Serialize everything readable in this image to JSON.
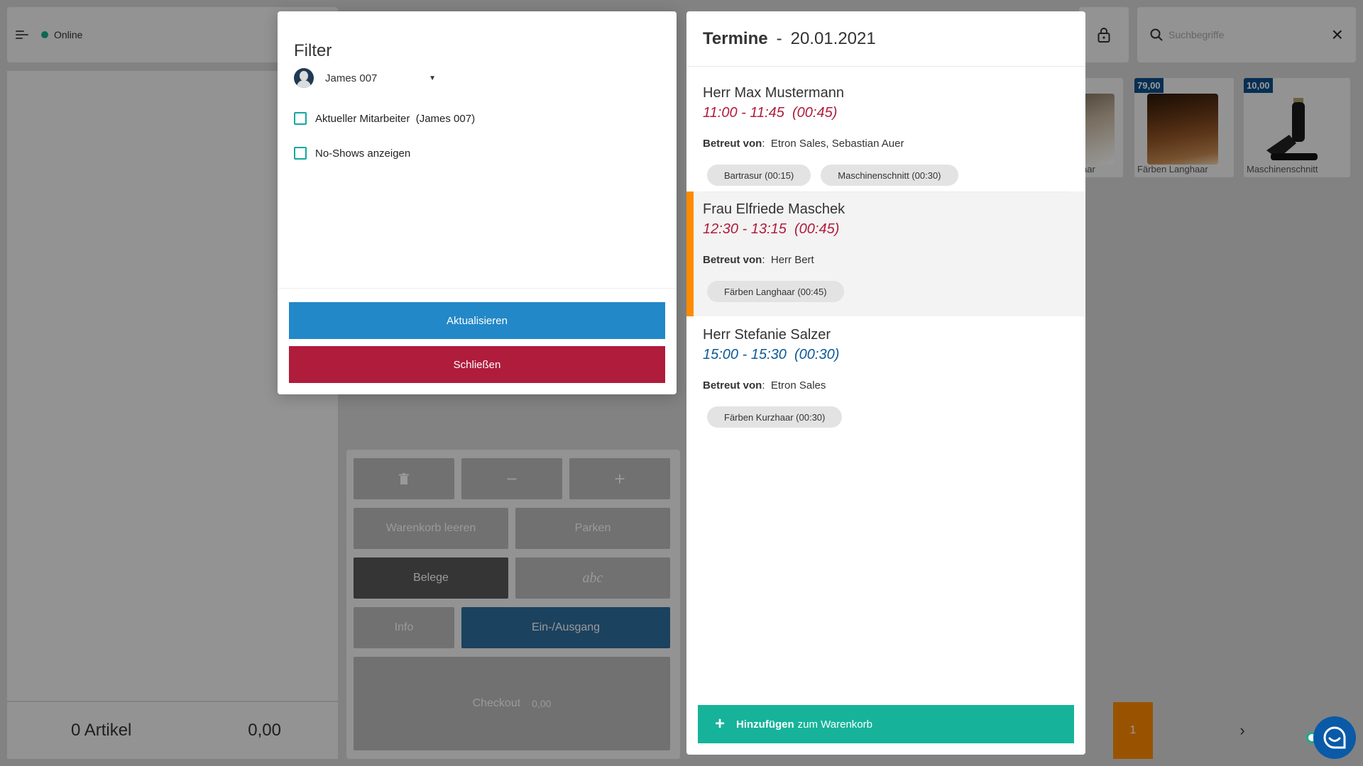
{
  "topbar": {
    "status_label": "Online",
    "search_placeholder": "Suchbegriffe"
  },
  "cart": {
    "article_count": "0 Artikel",
    "total": "0,00"
  },
  "buttons": {
    "delete_icon": "trash-icon",
    "minus": "−",
    "plus": "+",
    "clear_cart": "Warenkorb leeren",
    "park": "Parken",
    "receipts": "Belege",
    "abc": "abc",
    "info": "Info",
    "in_out": "Ein-/Ausgang",
    "checkout": "Checkout",
    "checkout_amount": "0,00"
  },
  "products": [
    {
      "label": "aar",
      "price": ""
    },
    {
      "label": "Färben Langhaar",
      "price": "79,00"
    },
    {
      "label": "Maschinenschnitt",
      "price": "10,00"
    }
  ],
  "pager": {
    "current": "1",
    "next": "›"
  },
  "filter": {
    "title": "Filter",
    "selected_user": "James 007",
    "checkbox_current": "Aktueller Mitarbeiter  (James 007)",
    "checkbox_noshows": "No-Shows anzeigen",
    "update_label": "Aktualisieren",
    "close_label": "Schließen"
  },
  "appointments": {
    "title": "Termine",
    "date": "20.01.2021",
    "staff_label": "Betreut von",
    "items": [
      {
        "name": "Herr Max Mustermann",
        "time": "11:00 - 11:45  (00:45)",
        "staff": "Etron Sales, Sebastian Auer",
        "services": [
          "Bartrasur (00:15)",
          "Maschinenschnitt (00:30)"
        ],
        "time_color": "#b01c3b"
      },
      {
        "name": "Frau Elfriede Maschek",
        "time": "12:30 - 13:15  (00:45)",
        "staff": "Herr Bert",
        "services": [
          "Färben Langhaar (00:45)"
        ],
        "time_color": "#b01c3b"
      },
      {
        "name": "Herr Stefanie Salzer",
        "time": "15:00 - 15:30  (00:30)",
        "staff": "Etron Sales",
        "services": [
          "Färben Kurzhaar (00:30)"
        ],
        "time_color": "#0d5a96"
      }
    ],
    "add_bold": "Hinzufügen",
    "add_rest": "zum Warenkorb"
  },
  "colors": {
    "accent_teal": "#16b39a",
    "update_blue": "#2288c8",
    "close_red": "#b01c3b",
    "selected_orange": "#ff8a00"
  }
}
